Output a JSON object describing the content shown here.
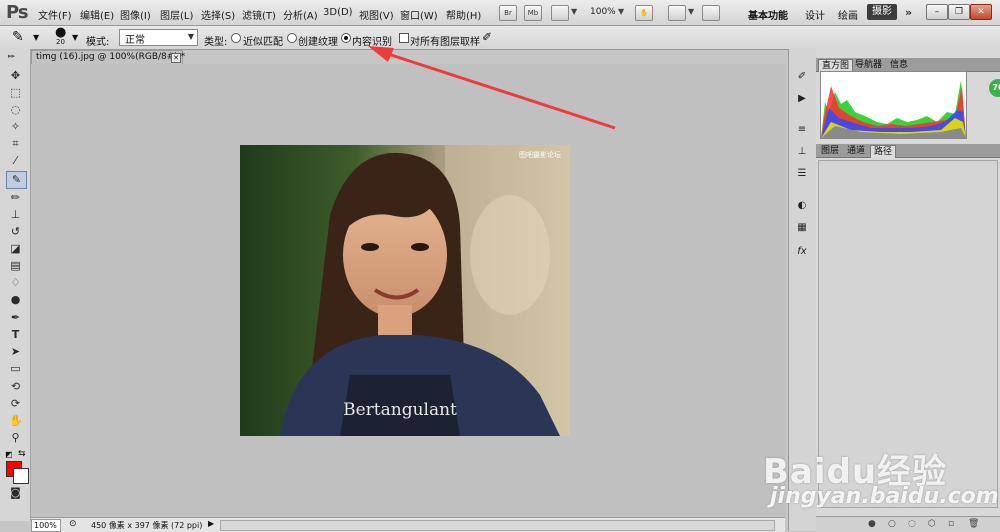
{
  "app": {
    "logo": "Ps"
  },
  "menu": [
    "文件(F)",
    "编辑(E)",
    "图像(I)",
    "图层(L)",
    "选择(S)",
    "滤镜(T)",
    "分析(A)",
    "3D(D)",
    "视图(V)",
    "窗口(W)",
    "帮助(H)"
  ],
  "menubar_buttons": {
    "bridge": "Br",
    "mini_bridge": "Mb",
    "zoom": "100%"
  },
  "workspaces": {
    "essentials": "基本功能",
    "design": "设计",
    "painting": "绘画",
    "photography": "摄影",
    "more": "»"
  },
  "window_controls": {
    "minimize": "–",
    "restore": "❐",
    "close": "✕"
  },
  "options": {
    "brush_size": "20",
    "mode_label": "模式:",
    "mode_value": "正常",
    "type_label": "类型:",
    "type_options": [
      "近似匹配",
      "创建纹理",
      "内容识别"
    ],
    "type_selected": "内容识别",
    "sample_all_label": "对所有图层取样"
  },
  "document": {
    "tab_title": "timg (16).jpg @ 100%(RGB/8#) *",
    "zoom": "100%",
    "info": "450 像素 x 397 像素 (72 ppi)"
  },
  "panels": {
    "top_tabs": [
      "直方图",
      "导航器",
      "信息"
    ],
    "top_active": "直方图",
    "bottom_tabs": [
      "图层",
      "通道",
      "路径"
    ],
    "bottom_active": "路径"
  },
  "badge": "70",
  "photo": {
    "watermark": "图吧摄影论坛",
    "shirt_text": "Bertangulant"
  },
  "watermark": {
    "brand": "Baidu经验",
    "url": "jingyan.baidu.com"
  }
}
